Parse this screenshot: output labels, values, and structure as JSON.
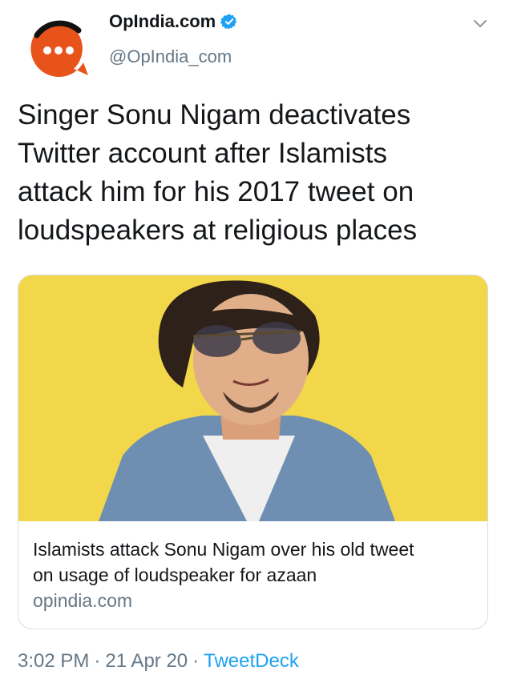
{
  "account": {
    "display_name": "OpIndia.com",
    "handle": "@OpIndia_com",
    "verified": true
  },
  "tweet": {
    "text_lines": [
      "Singer Sonu Nigam deactivates",
      "Twitter account after Islamists",
      "attack him for his 2017 tweet on",
      "loudspeakers at religious places"
    ]
  },
  "card": {
    "title_lines": [
      "Islamists attack Sonu Nigam over his old tweet",
      "on usage of loudspeaker for azaan"
    ],
    "domain": "opindia.com"
  },
  "meta": {
    "time": "3:02 PM",
    "separator": "·",
    "date": "21 Apr 20",
    "source": "TweetDeck"
  },
  "colors": {
    "brand_orange": "#e8521b",
    "link_blue": "#1da1f2",
    "card_background": "#f2d74a",
    "muted_text": "#657786"
  },
  "icons": {
    "avatar": "opindia-logo-icon",
    "verified": "verified-badge-icon",
    "menu": "chevron-down-icon"
  }
}
